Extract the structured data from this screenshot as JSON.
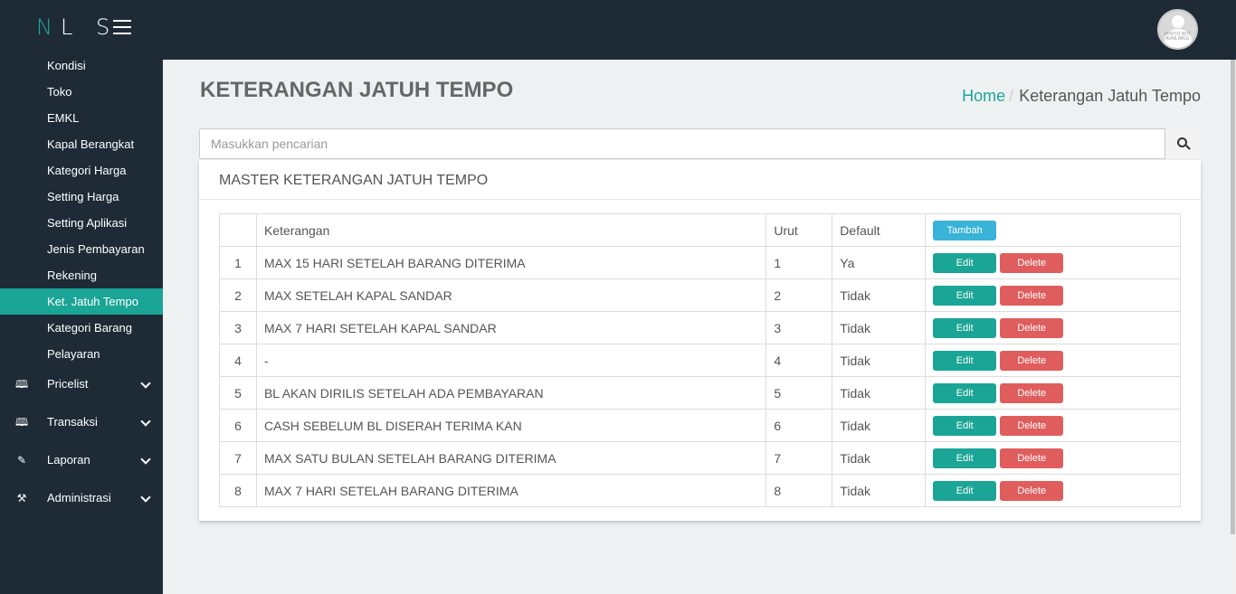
{
  "topbar": {
    "logo_first": "N",
    "logo_rest": "L S",
    "avatar_text": "PHOTO NOT AVAILABLE"
  },
  "sidebar": {
    "items": [
      "Kondisi",
      "Toko",
      "EMKL",
      "Kapal Berangkat",
      "Kategori Harga",
      "Setting Harga",
      "Setting Aplikasi",
      "Jenis Pembayaran",
      "Rekening",
      "Ket. Jatuh Tempo",
      "Kategori Barang",
      "Pelayaran"
    ],
    "active": "Ket. Jatuh Tempo",
    "groups": [
      {
        "label": "Pricelist",
        "icon": "map-icon"
      },
      {
        "label": "Transaksi",
        "icon": "map-icon"
      },
      {
        "label": "Laporan",
        "icon": "edit-icon"
      },
      {
        "label": "Administrasi",
        "icon": "wrench-icon"
      }
    ]
  },
  "page": {
    "title": "KETERANGAN JATUH TEMPO"
  },
  "breadcrumb": {
    "home": "Home",
    "current": "Keterangan Jatuh Tempo"
  },
  "search": {
    "placeholder": "Masukkan pencarian"
  },
  "panel": {
    "title": "MASTER KETERANGAN JATUH TEMPO"
  },
  "table": {
    "headers": {
      "no": "",
      "keterangan": "Keterangan",
      "urut": "Urut",
      "default": "Default"
    },
    "add_label": "Tambah",
    "edit_label": "Edit",
    "delete_label": "Delete",
    "rows": [
      {
        "no": "1",
        "keterangan": "MAX 15 HARI SETELAH BARANG DITERIMA",
        "urut": "1",
        "default": "Ya"
      },
      {
        "no": "2",
        "keterangan": "MAX SETELAH KAPAL SANDAR",
        "urut": "2",
        "default": "Tidak"
      },
      {
        "no": "3",
        "keterangan": "MAX 7 HARI SETELAH KAPAL SANDAR",
        "urut": "3",
        "default": "Tidak"
      },
      {
        "no": "4",
        "keterangan": "-",
        "urut": "4",
        "default": "Tidak"
      },
      {
        "no": "5",
        "keterangan": "BL AKAN DIRILIS SETELAH ADA PEMBAYARAN",
        "urut": "5",
        "default": "Tidak"
      },
      {
        "no": "6",
        "keterangan": "CASH SEBELUM BL DISERAH TERIMA KAN",
        "urut": "6",
        "default": "Tidak"
      },
      {
        "no": "7",
        "keterangan": "MAX SATU BULAN SETELAH BARANG DITERIMA",
        "urut": "7",
        "default": "Tidak"
      },
      {
        "no": "8",
        "keterangan": "MAX 7 HARI SETELAH BARANG DITERIMA",
        "urut": "8",
        "default": "Tidak"
      }
    ]
  }
}
